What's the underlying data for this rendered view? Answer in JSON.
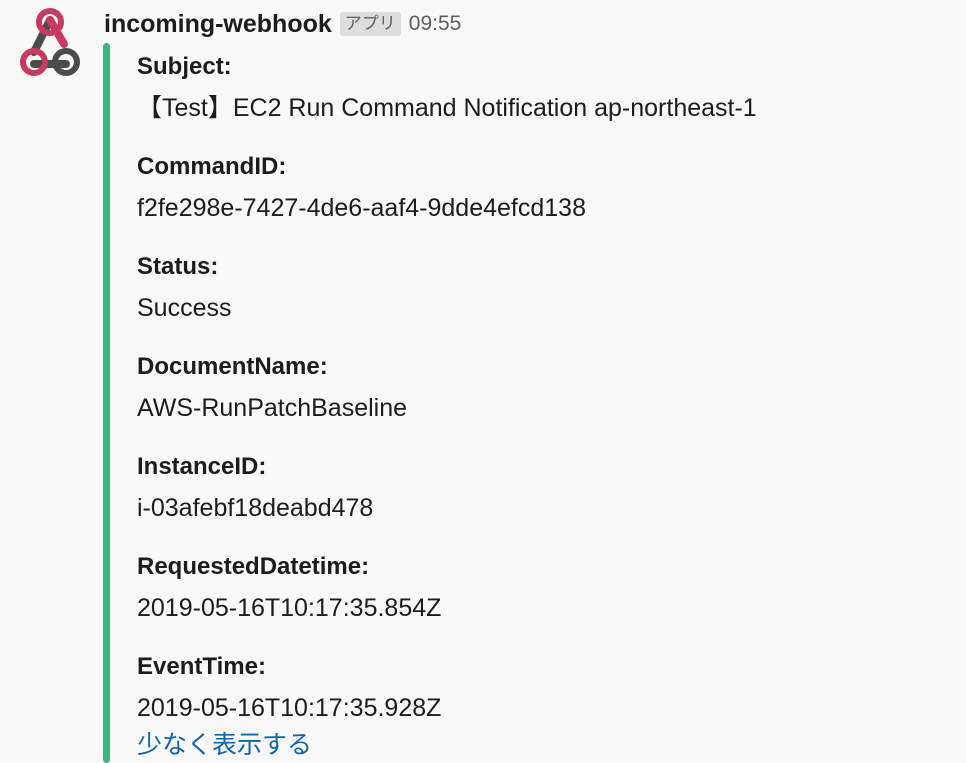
{
  "message": {
    "sender": "incoming-webhook",
    "badge": "アプリ",
    "time": "09:55",
    "avatar_icon": "webhook-icon"
  },
  "attachment": {
    "bar_color": "#3eb57f",
    "fields": [
      {
        "label": "Subject:",
        "value": "【Test】EC2 Run Command Notification ap-northeast-1"
      },
      {
        "label": "CommandID:",
        "value": "f2fe298e-7427-4de6-aaf4-9dde4efcd138"
      },
      {
        "label": "Status:",
        "value": "Success"
      },
      {
        "label": "DocumentName:",
        "value": "AWS-RunPatchBaseline"
      },
      {
        "label": "InstanceID:",
        "value": "i-03afebf18deabd478"
      },
      {
        "label": "RequestedDatetime:",
        "value": "2019-05-16T10:17:35.854Z"
      },
      {
        "label": "EventTime:",
        "value": "2019-05-16T10:17:35.928Z"
      }
    ],
    "show_less": "少なく表示する"
  },
  "colors": {
    "background": "#f8f8f8",
    "link": "#1264a3",
    "avatar_pink": "#c73a63",
    "avatar_dark": "#4b4b4b"
  }
}
